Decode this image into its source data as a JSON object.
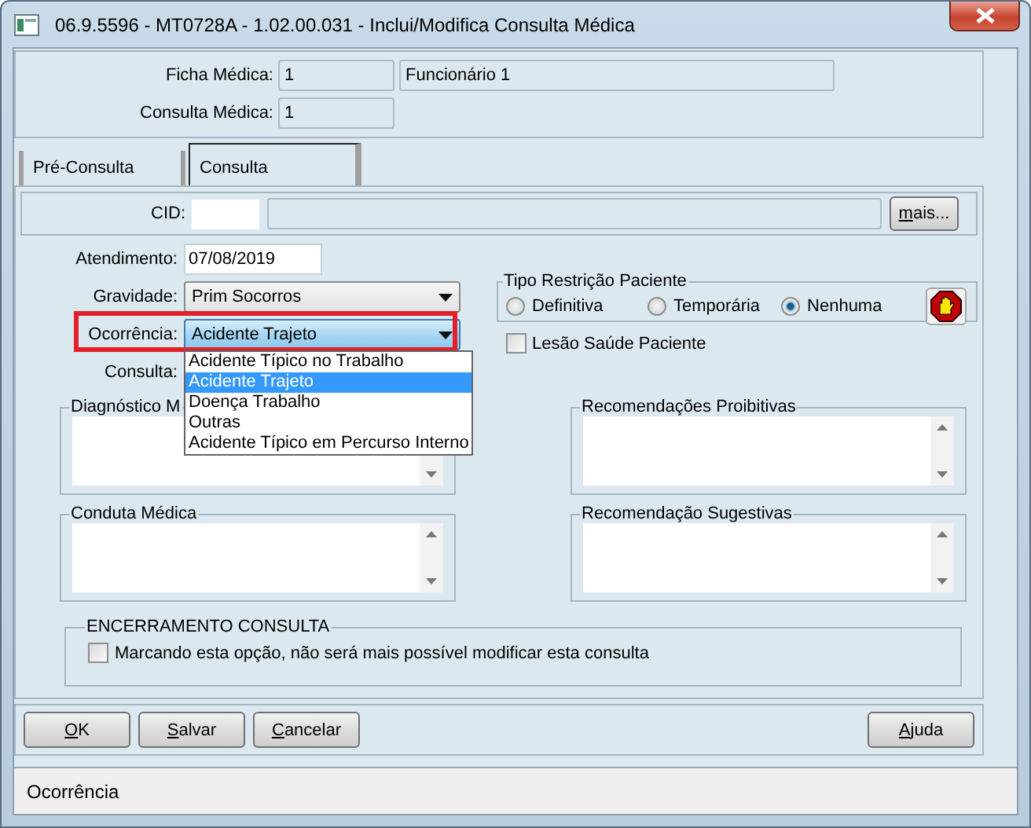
{
  "window": {
    "title": "06.9.5596 - MT0728A - 1.02.00.031 - Inclui/Modifica Consulta Médica"
  },
  "header": {
    "fields": [
      {
        "label": "Ficha Médica:",
        "value": "1",
        "description": "Funcionário 1"
      },
      {
        "label": "Consulta Médica:",
        "value": "1"
      }
    ]
  },
  "tabs": [
    {
      "label": "Pré-Consulta",
      "selected": false
    },
    {
      "label": "Consulta",
      "selected": true
    }
  ],
  "cid": {
    "label": "CID:",
    "button": "mais..."
  },
  "form_fields": [
    {
      "kind": "text",
      "label": "Atendimento:",
      "value": "07/08/2019"
    },
    {
      "kind": "combo",
      "label": "Gravidade:",
      "value": "Prim Socorros",
      "open": false
    },
    {
      "kind": "combo",
      "label": "Ocorrência:",
      "value": "Acidente Trajeto",
      "highlighted": true,
      "open": true,
      "options": [
        {
          "label": "Acidente Típico no Trabalho",
          "selected": false
        },
        {
          "label": "Acidente Trajeto",
          "selected": true
        },
        {
          "label": "Doença Trabalho",
          "selected": false
        },
        {
          "label": "Outras",
          "selected": false
        },
        {
          "label": "Acidente Típico em Percurso Interno",
          "selected": false
        }
      ]
    },
    {
      "kind": "covered",
      "label": "Consulta:"
    }
  ],
  "restriction": {
    "title": "Tipo Restrição Paciente",
    "options": [
      {
        "label": "Definitiva",
        "selected": false
      },
      {
        "label": "Temporária",
        "selected": false
      },
      {
        "label": "Nenhuma",
        "selected": true
      }
    ]
  },
  "injury_checkbox": {
    "label": "Lesão Saúde Paciente",
    "checked": false
  },
  "text_groups": [
    {
      "title": "Diagnóstico M"
    },
    {
      "title": "Recomendações Proibitivas"
    },
    {
      "title": "Conduta Médica"
    },
    {
      "title": "Recomendação Sugestivas"
    }
  ],
  "closing": {
    "title": "ENCERRAMENTO CONSULTA",
    "checkbox": {
      "label": "Marcando esta opção, não será mais possível modificar esta consulta",
      "checked": false
    }
  },
  "buttons_left": [
    "OK",
    "Salvar",
    "Cancelar"
  ],
  "buttons_right": [
    "Ajuda"
  ],
  "status_bar": "Ocorrência"
}
